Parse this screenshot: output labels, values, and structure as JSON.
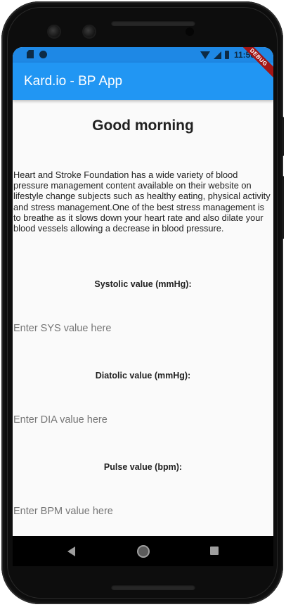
{
  "status_bar": {
    "time": "11:58",
    "icons": [
      "sd-card-icon",
      "circle-icon",
      "wifi-icon",
      "signal-icon",
      "battery-icon"
    ]
  },
  "debug_banner": "DEBUG",
  "app_bar": {
    "title": "Kard.io - BP App",
    "color": "#2196f3"
  },
  "content": {
    "greeting": "Good morning",
    "info_text": "Heart and Stroke Foundation has a wide variety of blood pressure management content available on their website on lifestyle change subjects such as healthy eating, physical activity and stress management.One of the best stress management is to breathe as it slows down your heart rate and also dilate your blood vessels allowing a decrease in blood pressure.",
    "fields": [
      {
        "label": "Systolic value (mmHg):",
        "placeholder": "Enter SYS value here",
        "value": ""
      },
      {
        "label": "Diatolic value (mmHg):",
        "placeholder": "Enter DIA value here",
        "value": ""
      },
      {
        "label": "Pulse value (bpm):",
        "placeholder": "Enter BPM value here",
        "value": ""
      }
    ]
  },
  "nav_bar": {
    "buttons": [
      "back-icon",
      "home-icon",
      "recents-icon"
    ]
  }
}
